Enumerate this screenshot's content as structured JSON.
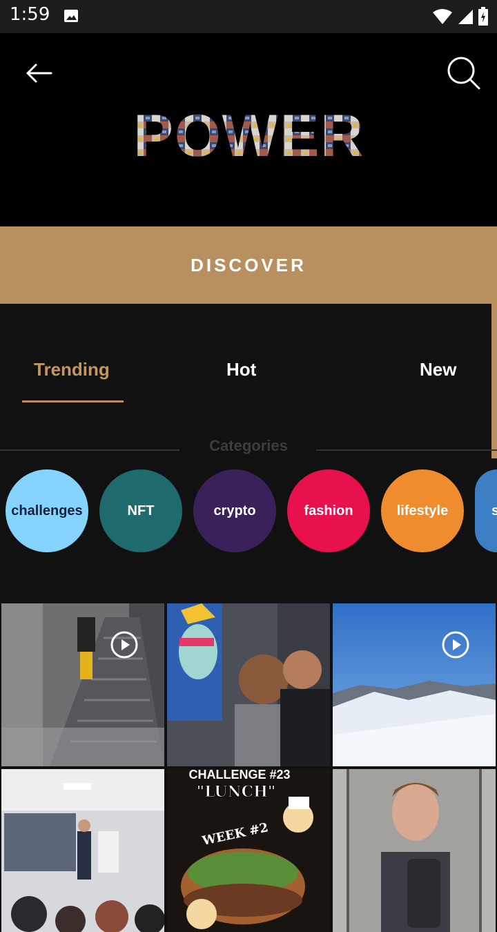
{
  "status_bar": {
    "time": "1:59"
  },
  "header": {
    "logo_text": "POWER"
  },
  "banner": {
    "label": "DISCOVER"
  },
  "tabs": [
    {
      "label": "Trending"
    },
    {
      "label": "Hot"
    },
    {
      "label": "New"
    }
  ],
  "categories": {
    "title": "Categories",
    "items": [
      {
        "label": "challenges"
      },
      {
        "label": "NFT"
      },
      {
        "label": "crypto"
      },
      {
        "label": "fashion"
      },
      {
        "label": "lifestyle"
      },
      {
        "label": "s"
      }
    ]
  },
  "colors": {
    "accent": "#b88f5e",
    "chip_challenges": "#86d3ff",
    "chip_nft": "#1f6b6e",
    "chip_crypto": "#3a2159",
    "chip_fashion": "#e8104d",
    "chip_lifestyle": "#ef8d2e",
    "chip_sports": "#3d7fc4"
  },
  "grid": {
    "tile_captions": [
      "CHALLENGE #23",
      "\"LUNCH\"",
      "WEEK #2"
    ]
  }
}
